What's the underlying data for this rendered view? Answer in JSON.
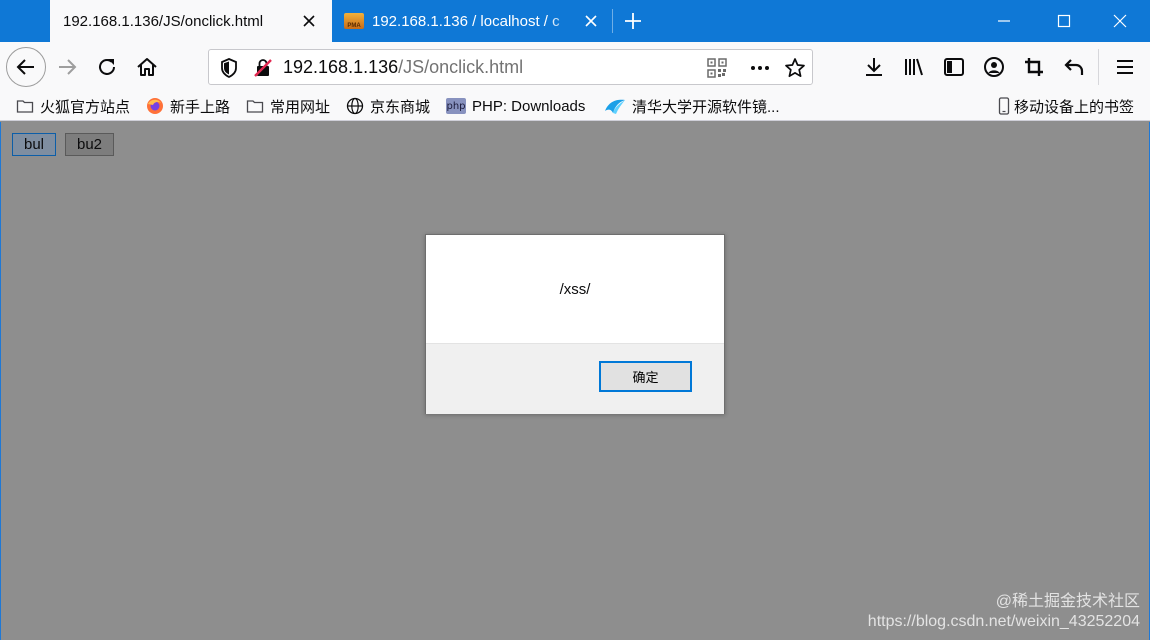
{
  "tabs": [
    {
      "title": "192.168.1.136/JS/onclick.html",
      "active": true
    },
    {
      "title": "192.168.1.136 / localhost / c",
      "active": false,
      "favicon_label": "PMA"
    }
  ],
  "urlbar": {
    "host": "192.168.1.136",
    "path": "/JS/onclick.html"
  },
  "bookmarks": {
    "items": [
      {
        "label": "火狐官方站点",
        "icon": "folder-icon"
      },
      {
        "label": "新手上路",
        "icon": "firefox-icon"
      },
      {
        "label": "常用网址",
        "icon": "folder-icon"
      },
      {
        "label": "京东商城",
        "icon": "globe-icon"
      },
      {
        "label": "PHP: Downloads",
        "icon": "php-icon",
        "icon_text": "php"
      },
      {
        "label": "清华大学开源软件镜...",
        "icon": "tsinghua-icon"
      }
    ],
    "mobile_label": "移动设备上的书签"
  },
  "page": {
    "buttons": [
      {
        "label": "bul"
      },
      {
        "label": "bu2"
      }
    ]
  },
  "dialog": {
    "message": "/xss/",
    "ok_label": "确定"
  },
  "watermark": {
    "line1": "@稀土掘金技术社区",
    "line2": "https://blog.csdn.net/weixin_43252204"
  },
  "colors": {
    "titlebar": "#0f78d6",
    "page_overlay": "#8e8e8e",
    "dialog_focus": "#0078d7"
  }
}
